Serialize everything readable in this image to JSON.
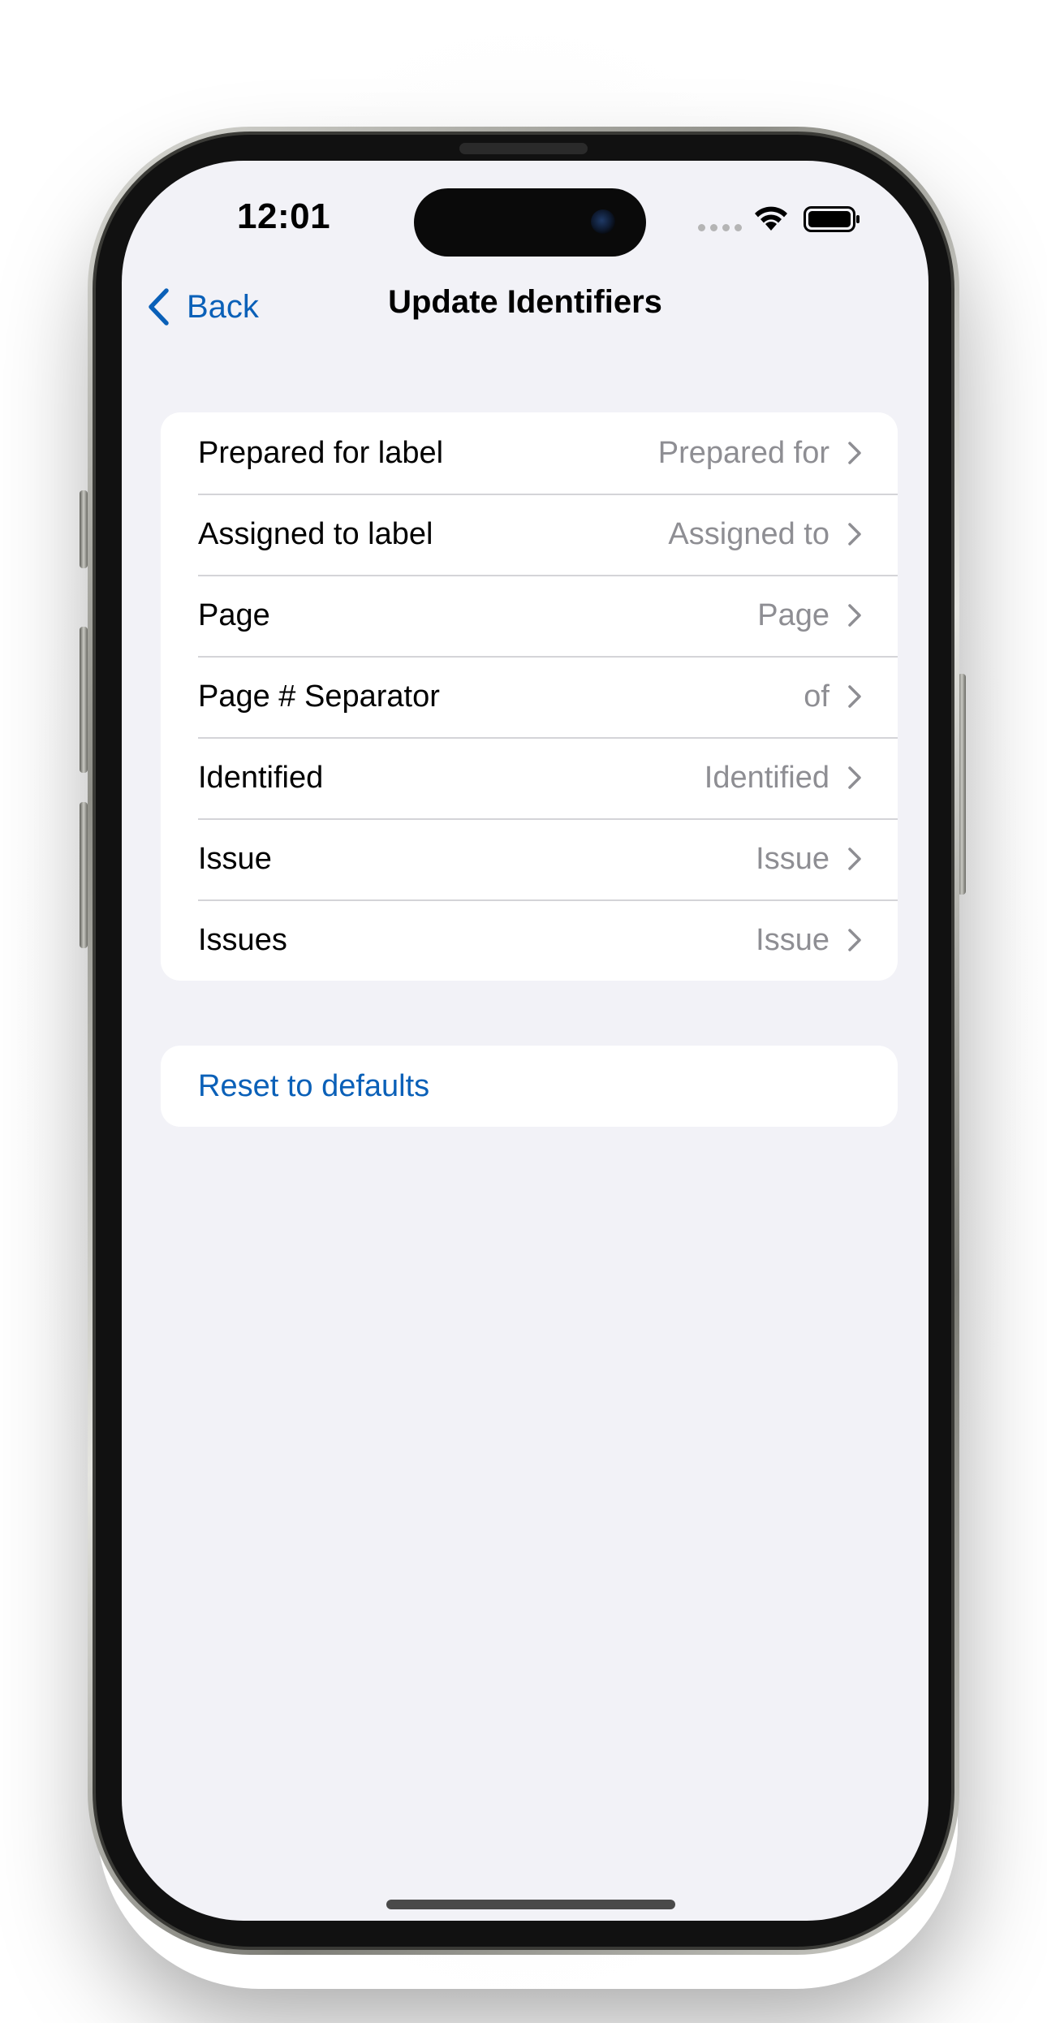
{
  "status_bar": {
    "time": "12:01"
  },
  "nav": {
    "back_label": "Back",
    "title": "Update Identifiers"
  },
  "identifiers": {
    "rows": [
      {
        "label": "Prepared for label",
        "value": "Prepared for"
      },
      {
        "label": "Assigned to label",
        "value": "Assigned to"
      },
      {
        "label": "Page",
        "value": "Page"
      },
      {
        "label": "Page # Separator",
        "value": "of"
      },
      {
        "label": "Identified",
        "value": "Identified"
      },
      {
        "label": "Issue",
        "value": "Issue"
      },
      {
        "label": "Issues",
        "value": "Issue"
      }
    ]
  },
  "actions": {
    "reset_label": "Reset to defaults"
  },
  "icons": {
    "back": "chevron-left-icon",
    "row_disclosure": "chevron-right-icon",
    "wifi": "wifi-icon",
    "battery": "battery-icon",
    "signal": "cellular-signal-icon"
  },
  "colors": {
    "accent": "#0a60b8",
    "background": "#f2f2f7",
    "secondary_text": "#8e8e93",
    "card": "#ffffff"
  }
}
